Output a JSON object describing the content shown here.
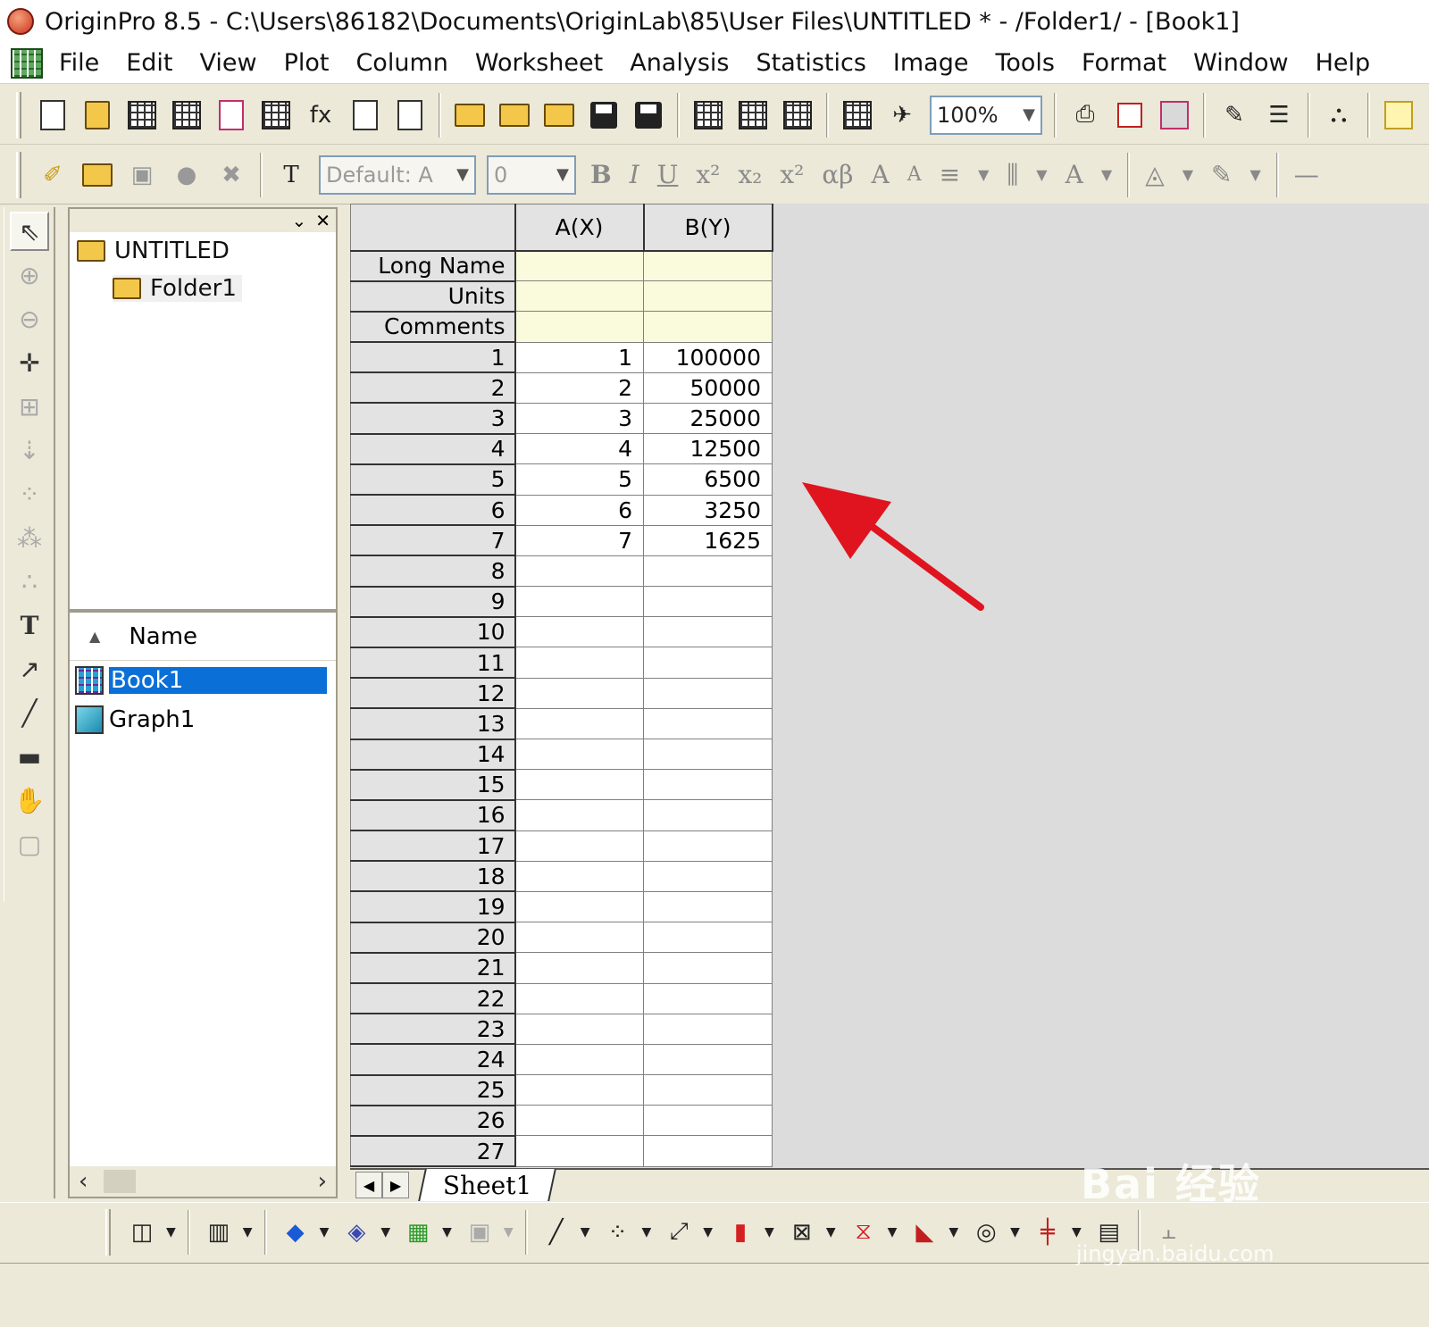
{
  "window": {
    "title": "OriginPro 8.5 - C:\\Users\\86182\\Documents\\OriginLab\\85\\User Files\\UNTITLED * - /Folder1/ - [Book1]"
  },
  "menu": [
    "File",
    "Edit",
    "View",
    "Plot",
    "Column",
    "Worksheet",
    "Analysis",
    "Statistics",
    "Image",
    "Tools",
    "Format",
    "Window",
    "Help"
  ],
  "toolbar": {
    "zoom_value": "100%",
    "font_name": "Default: A",
    "font_size": "0"
  },
  "project_explorer": {
    "root_folder": "UNTITLED",
    "subfolder": "Folder1",
    "name_header": "Name",
    "items": [
      {
        "label": "Book1",
        "selected": true
      },
      {
        "label": "Graph1",
        "selected": false
      }
    ]
  },
  "worksheet": {
    "columns": [
      "A(X)",
      "B(Y)"
    ],
    "meta_rows": [
      "Long Name",
      "Units",
      "Comments"
    ],
    "row_count": 27,
    "data": [
      [
        "1",
        "100000"
      ],
      [
        "2",
        "50000"
      ],
      [
        "3",
        "25000"
      ],
      [
        "4",
        "12500"
      ],
      [
        "5",
        "6500"
      ],
      [
        "6",
        "3250"
      ],
      [
        "7",
        "1625"
      ]
    ],
    "sheet_tab": "Sheet1"
  },
  "annotation": {
    "arrow_color": "#e0141e"
  },
  "watermark": {
    "text": "Bai 经验",
    "url": "jingyan.baidu.com"
  }
}
